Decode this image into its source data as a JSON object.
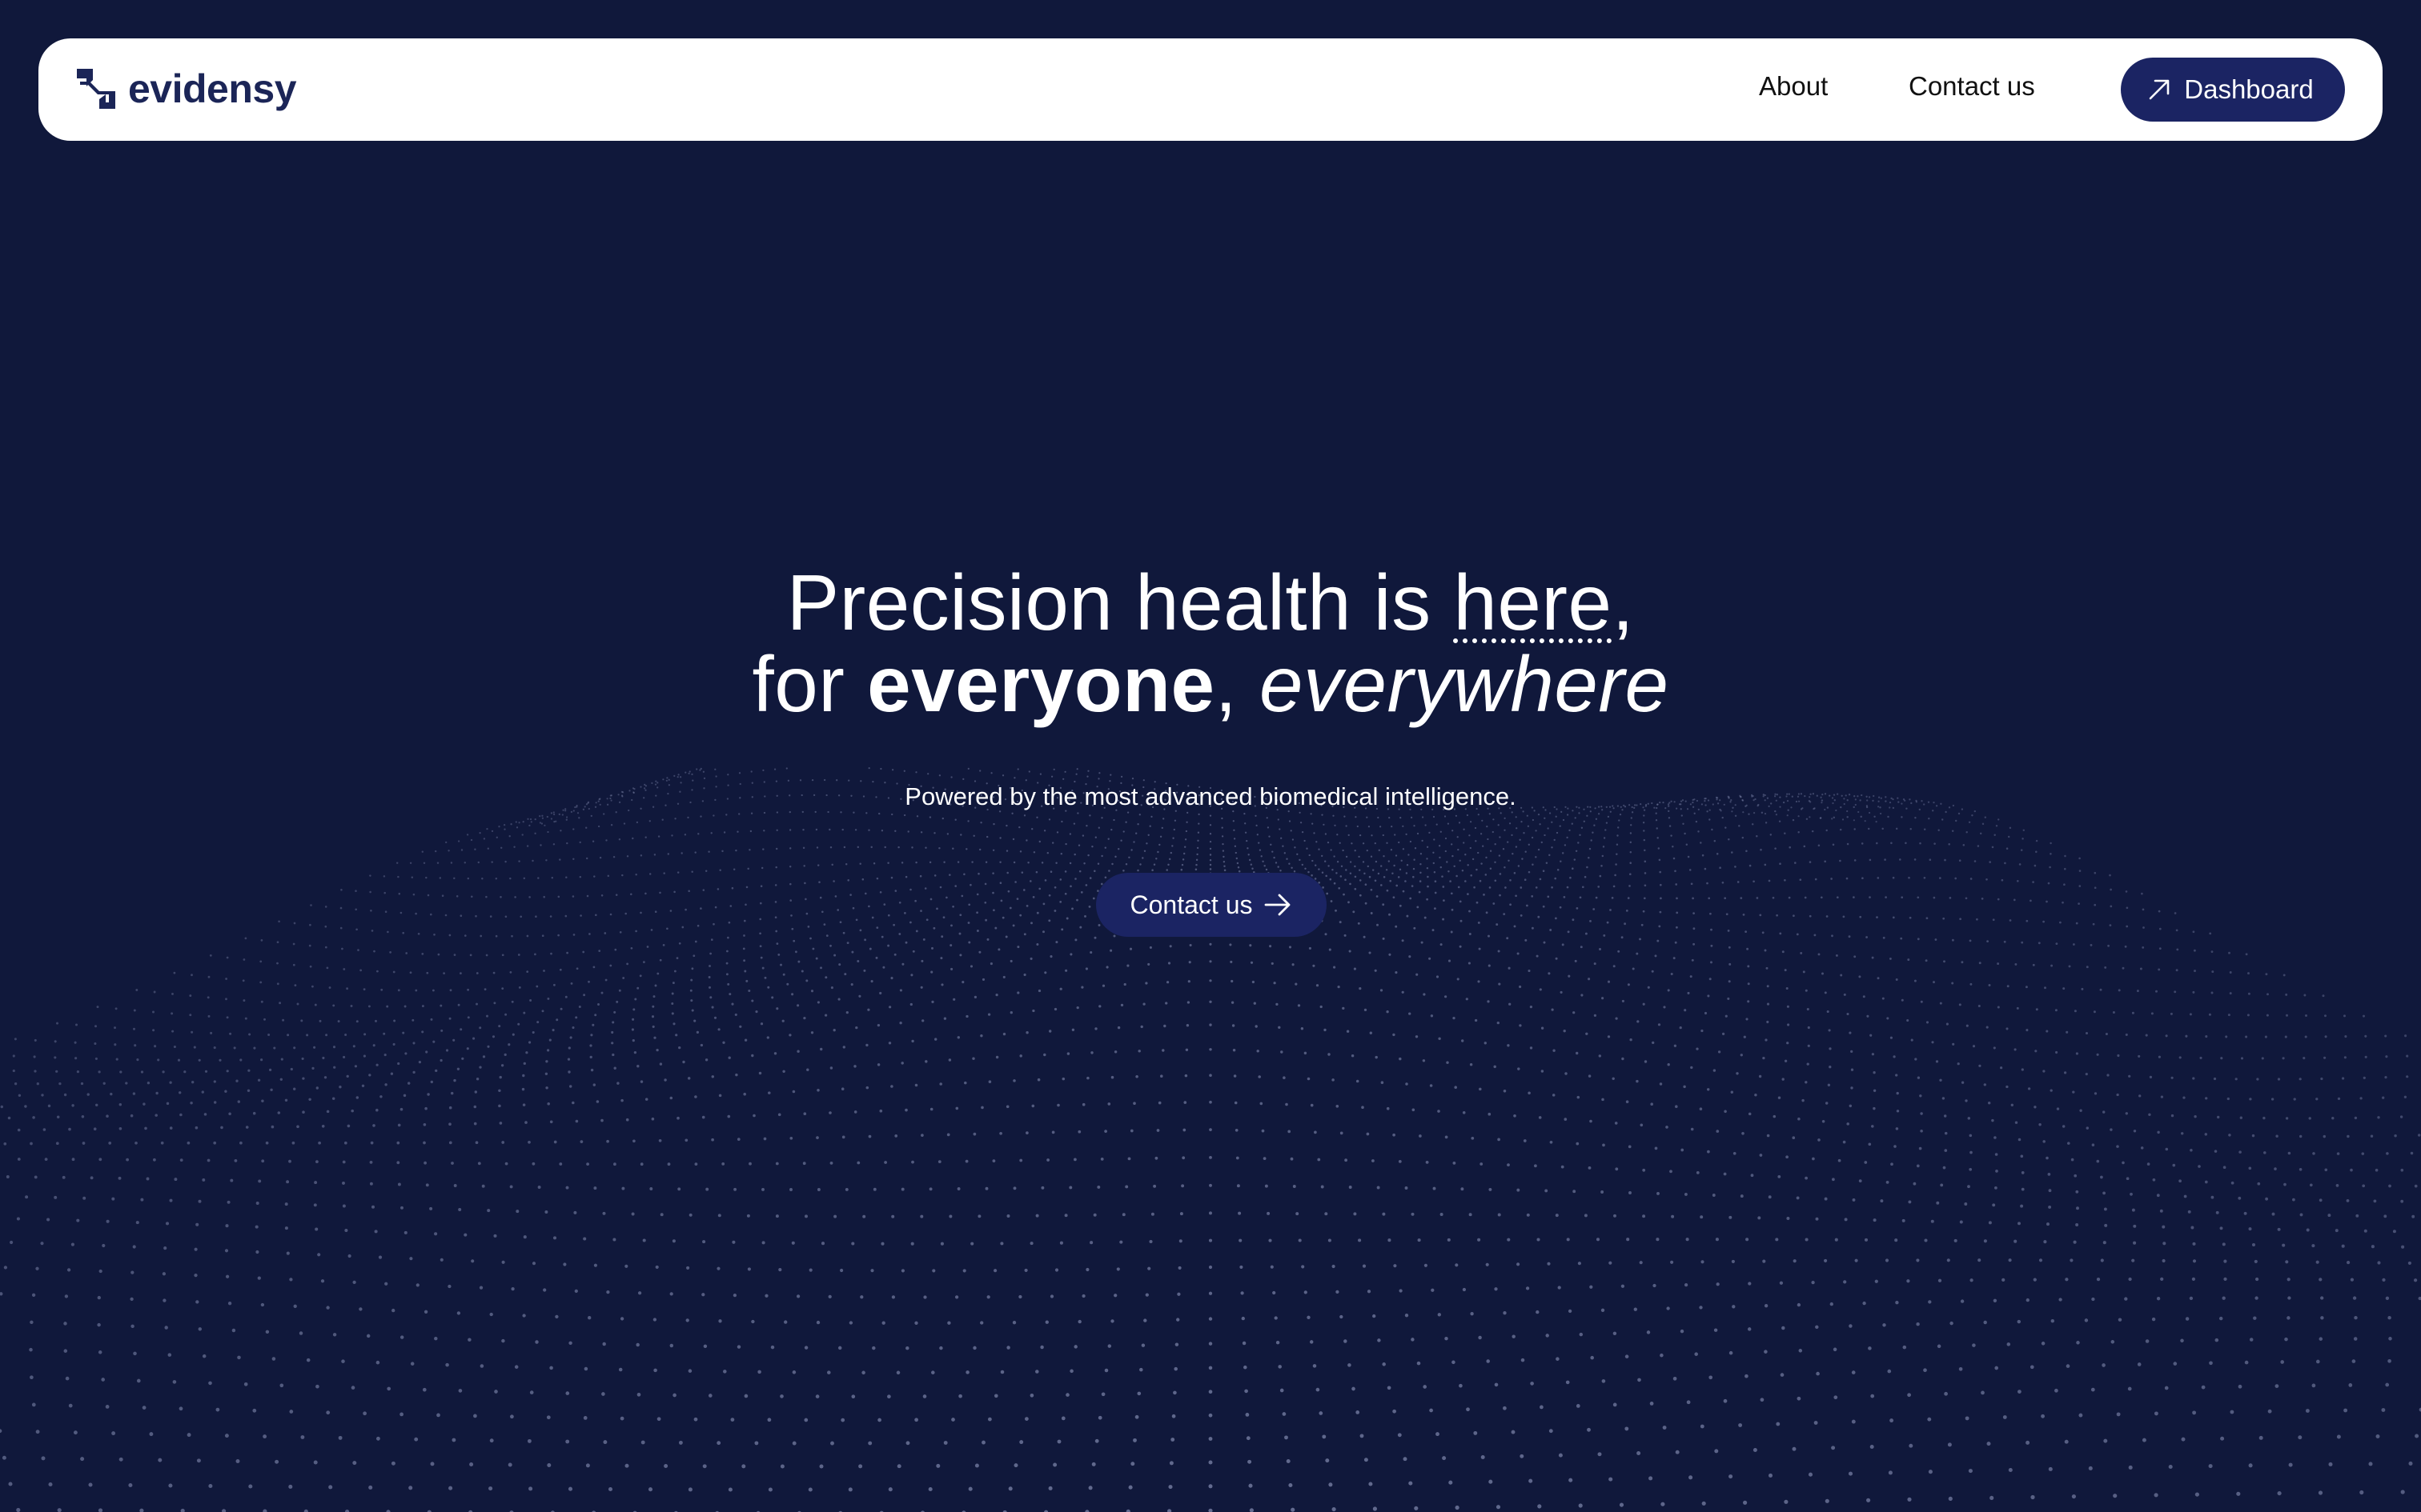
{
  "brand": {
    "name": "evidensy",
    "logo_icon": "evidensy-logo-mark",
    "color": "#1b2557"
  },
  "nav": {
    "about_label": "About",
    "contact_label": "Contact us",
    "dashboard_label": "Dashboard",
    "dashboard_icon": "arrow-up-right-icon"
  },
  "hero": {
    "line1_prefix": "Precision health is ",
    "line1_emphasis": "here",
    "line1_suffix": ",",
    "line2_prefix": "for ",
    "line2_bold": "everyone",
    "line2_mid": ", ",
    "line2_italic": "everywhere",
    "subtitle": "Powered by the most advanced biomedical intelligence.",
    "cta_label": "Contact us",
    "cta_icon": "arrow-right-icon"
  },
  "colors": {
    "background": "#10183b",
    "nav_background": "#ffffff",
    "button_background": "#1b2463",
    "dot_color": "#8b93b8"
  }
}
